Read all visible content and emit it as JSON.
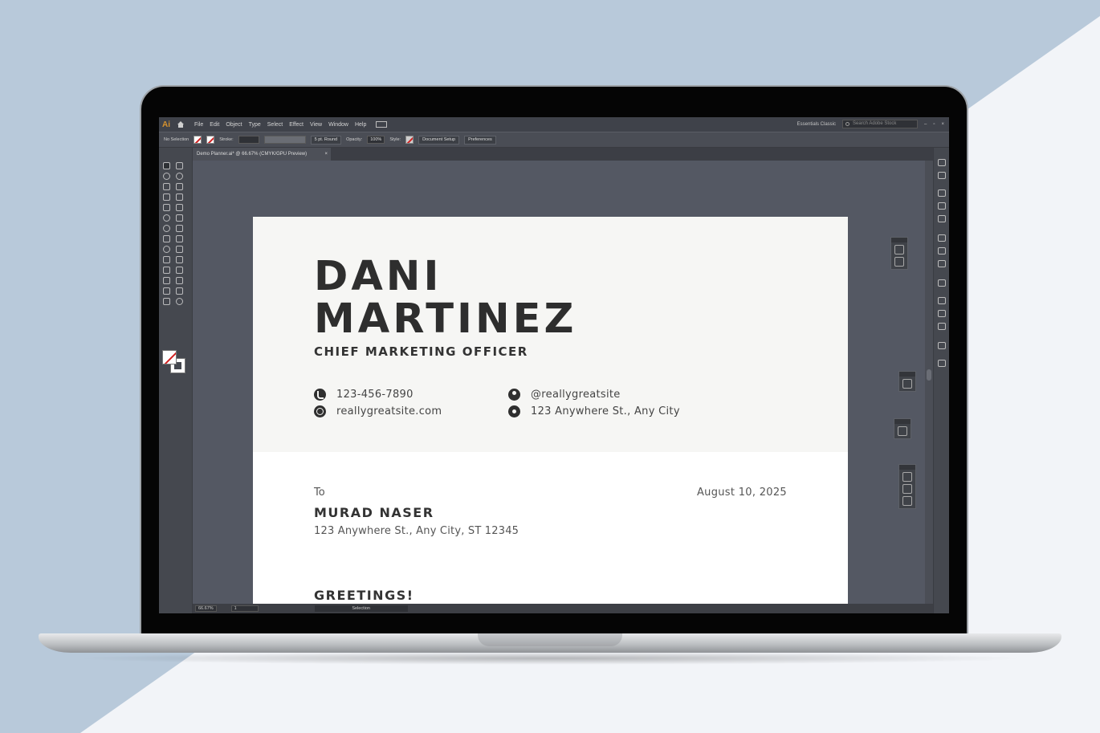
{
  "menubar": {
    "logo": "Ai",
    "items": [
      "File",
      "Edit",
      "Object",
      "Type",
      "Select",
      "Effect",
      "View",
      "Window",
      "Help"
    ],
    "workspace": "Essentials Classic",
    "search_placeholder": "Search Adobe Stock"
  },
  "controlbar": {
    "selection": "No Selection",
    "stroke_label": "Stroke:",
    "brush": "5 pt. Round",
    "opacity_label": "Opacity:",
    "opacity_value": "100%",
    "style_label": "Style:",
    "doc_setup": "Document Setup",
    "preferences": "Preferences"
  },
  "document_tab": {
    "title": "Demo Planner.ai* @ 66.67% (CMYK/GPU Preview)",
    "close": "×"
  },
  "statusbar": {
    "zoom": "66.67%",
    "artboard": "1",
    "mode": "Selection"
  },
  "artboard": {
    "name_line1": "DANI",
    "name_line2": "MARTINEZ",
    "role": "CHIEF MARKETING OFFICER",
    "contacts": {
      "phone": "123-456-7890",
      "website": "reallygreatsite.com",
      "social": "@reallygreatsite",
      "address": "123 Anywhere St., Any City"
    },
    "to_label": "To",
    "date": "August 10, 2025",
    "recipient": "MURAD NASER",
    "recipient_address": "123 Anywhere St., Any City, ST 12345",
    "greeting": "GREETINGS!"
  },
  "colors": {
    "background": "#b8c9da",
    "background_light": "#f2f4f8",
    "app_bg": "#535660",
    "canvas_bg": "#545863",
    "ai_orange": "#d6922e",
    "header_bg": "#f6f6f4",
    "text_dark": "#2e2e2e"
  },
  "icons": [
    "home-icon",
    "phone-icon",
    "globe-icon",
    "user-icon",
    "location-pin-icon",
    "search-icon",
    "close-icon"
  ]
}
